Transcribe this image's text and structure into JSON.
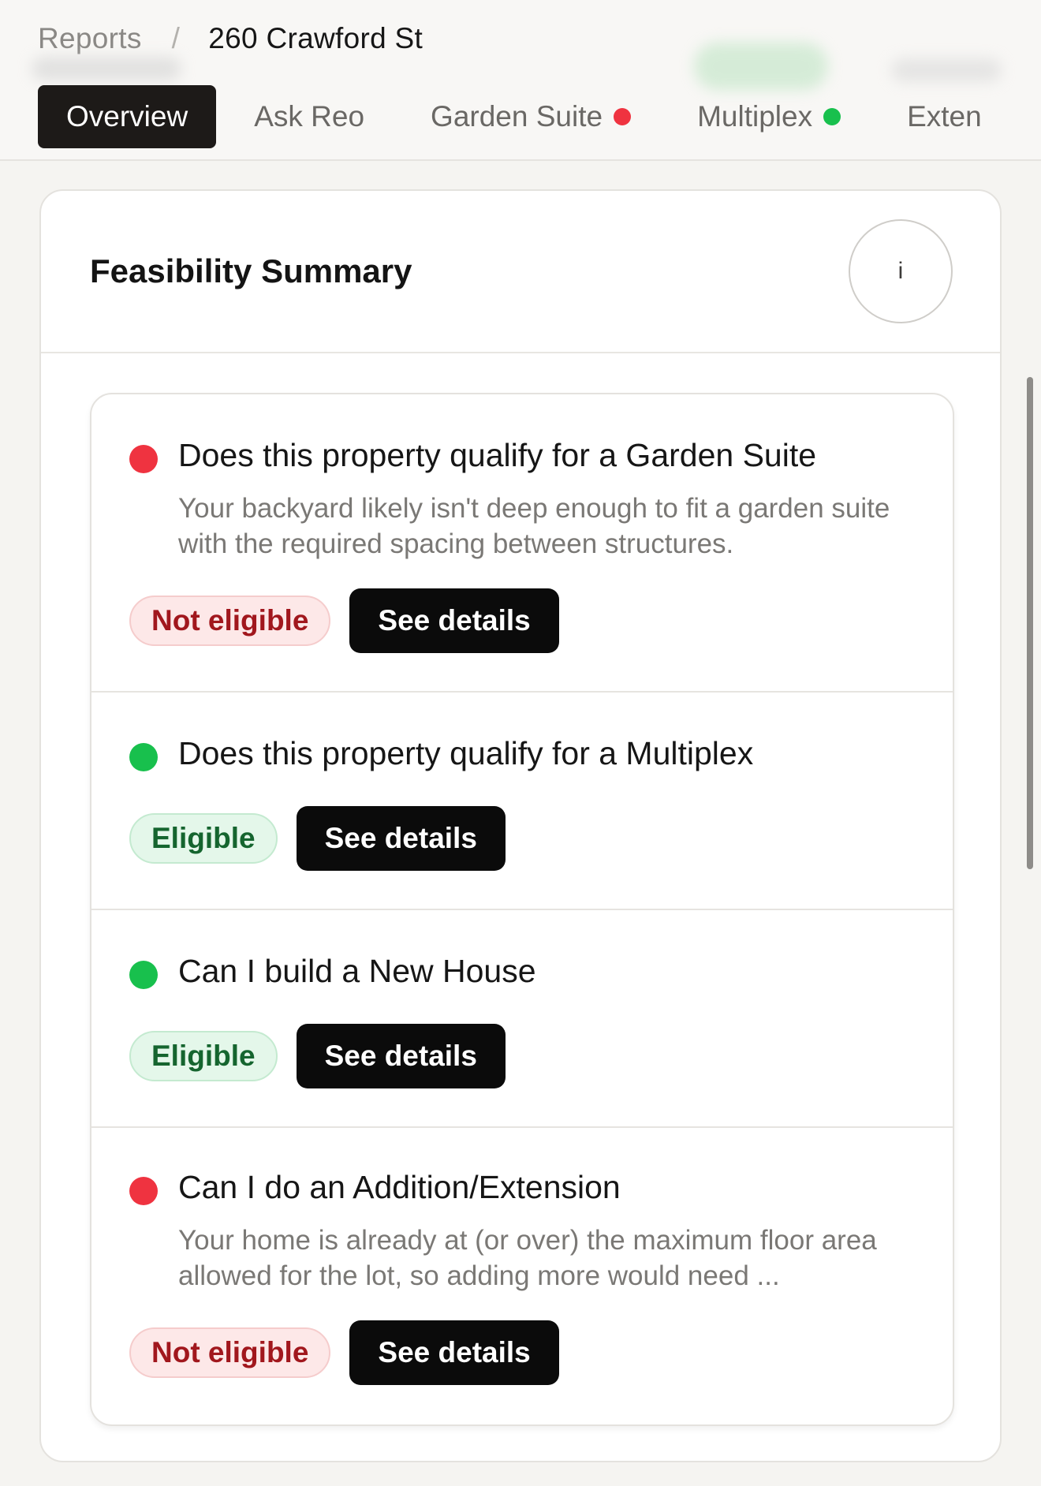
{
  "colors": {
    "red": "#ef3340",
    "green": "#18c04d",
    "dark": "#0b0b0b"
  },
  "breadcrumb": {
    "root": "Reports",
    "separator": "/",
    "current": "260 Crawford St"
  },
  "tabs": [
    {
      "label": "Overview",
      "active": true,
      "status": ""
    },
    {
      "label": "Ask Reo",
      "active": false,
      "status": ""
    },
    {
      "label": "Garden Suite",
      "active": false,
      "status": "red"
    },
    {
      "label": "Multiplex",
      "active": false,
      "status": "green"
    },
    {
      "label": "Exten",
      "active": false,
      "status": ""
    }
  ],
  "card": {
    "title": "Feasibility Summary",
    "info_label": "i"
  },
  "items": [
    {
      "status": "red",
      "question": "Does this property qualify for a Garden Suite",
      "description": "Your backyard likely isn't deep enough to fit a garden suite with the required spacing between structures.",
      "badge": "Not eligible",
      "button": "See details"
    },
    {
      "status": "green",
      "question": "Does this property qualify for a Multiplex",
      "description": "",
      "badge": "Eligible",
      "button": "See details"
    },
    {
      "status": "green",
      "question": "Can I build a New House",
      "description": "",
      "badge": "Eligible",
      "button": "See details"
    },
    {
      "status": "red",
      "question": "Can I do an Addition/Extension",
      "description": "Your home is already at (or over) the maximum floor area allowed for the lot, so adding more would need ...",
      "badge": "Not eligible",
      "button": "See details"
    }
  ]
}
